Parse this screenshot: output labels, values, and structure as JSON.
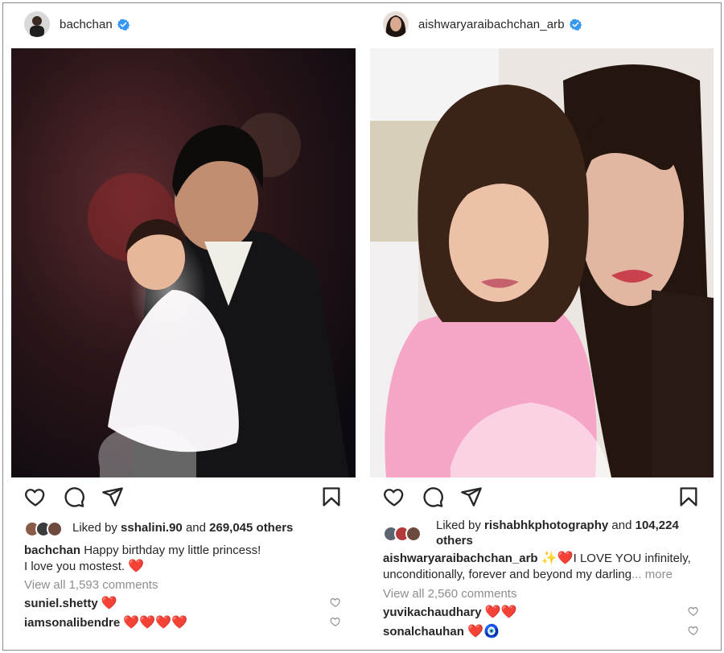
{
  "posts": [
    {
      "username": "bachchan",
      "liked_by_user": "sshalini.90",
      "liked_by_and": "and",
      "liked_by_count": "269,045 others",
      "liked_by_prefix": "Liked by",
      "caption_user": "bachchan",
      "caption_line1": "Happy birthday my little princess!",
      "caption_line2": "I love you mostest.",
      "caption_emoji": "❤️",
      "view_all": "View all 1,593 comments",
      "comments": [
        {
          "user": "suniel.shetty",
          "text": "❤️"
        },
        {
          "user": "iamsonalibendre",
          "text": "❤️❤️❤️❤️"
        }
      ]
    },
    {
      "username": "aishwaryaraibachchan_arb",
      "liked_by_prefix": "Liked by",
      "liked_by_user": "rishabhkphotography",
      "liked_by_and": "and",
      "liked_by_count": "104,224",
      "liked_by_count2": "others",
      "caption_user": "aishwaryaraibachchan_arb",
      "caption_emoji": "✨❤️",
      "caption_line1": "I LOVE YOU infinitely,",
      "caption_line2": "unconditionally, forever and beyond my darling",
      "caption_more": "... more",
      "view_all": "View all 2,560 comments",
      "comments": [
        {
          "user": "yuvikachaudhary",
          "text": "❤️❤️"
        },
        {
          "user": "sonalchauhan",
          "text": "❤️🧿"
        }
      ]
    }
  ],
  "colors": {
    "verified": "#3897f0",
    "text": "#262626",
    "muted": "#8e8e8e",
    "heart": "#e0245e"
  },
  "icons": [
    "heart-icon",
    "comment-icon",
    "share-icon",
    "bookmark-icon",
    "verified-badge-icon",
    "small-heart-icon"
  ]
}
